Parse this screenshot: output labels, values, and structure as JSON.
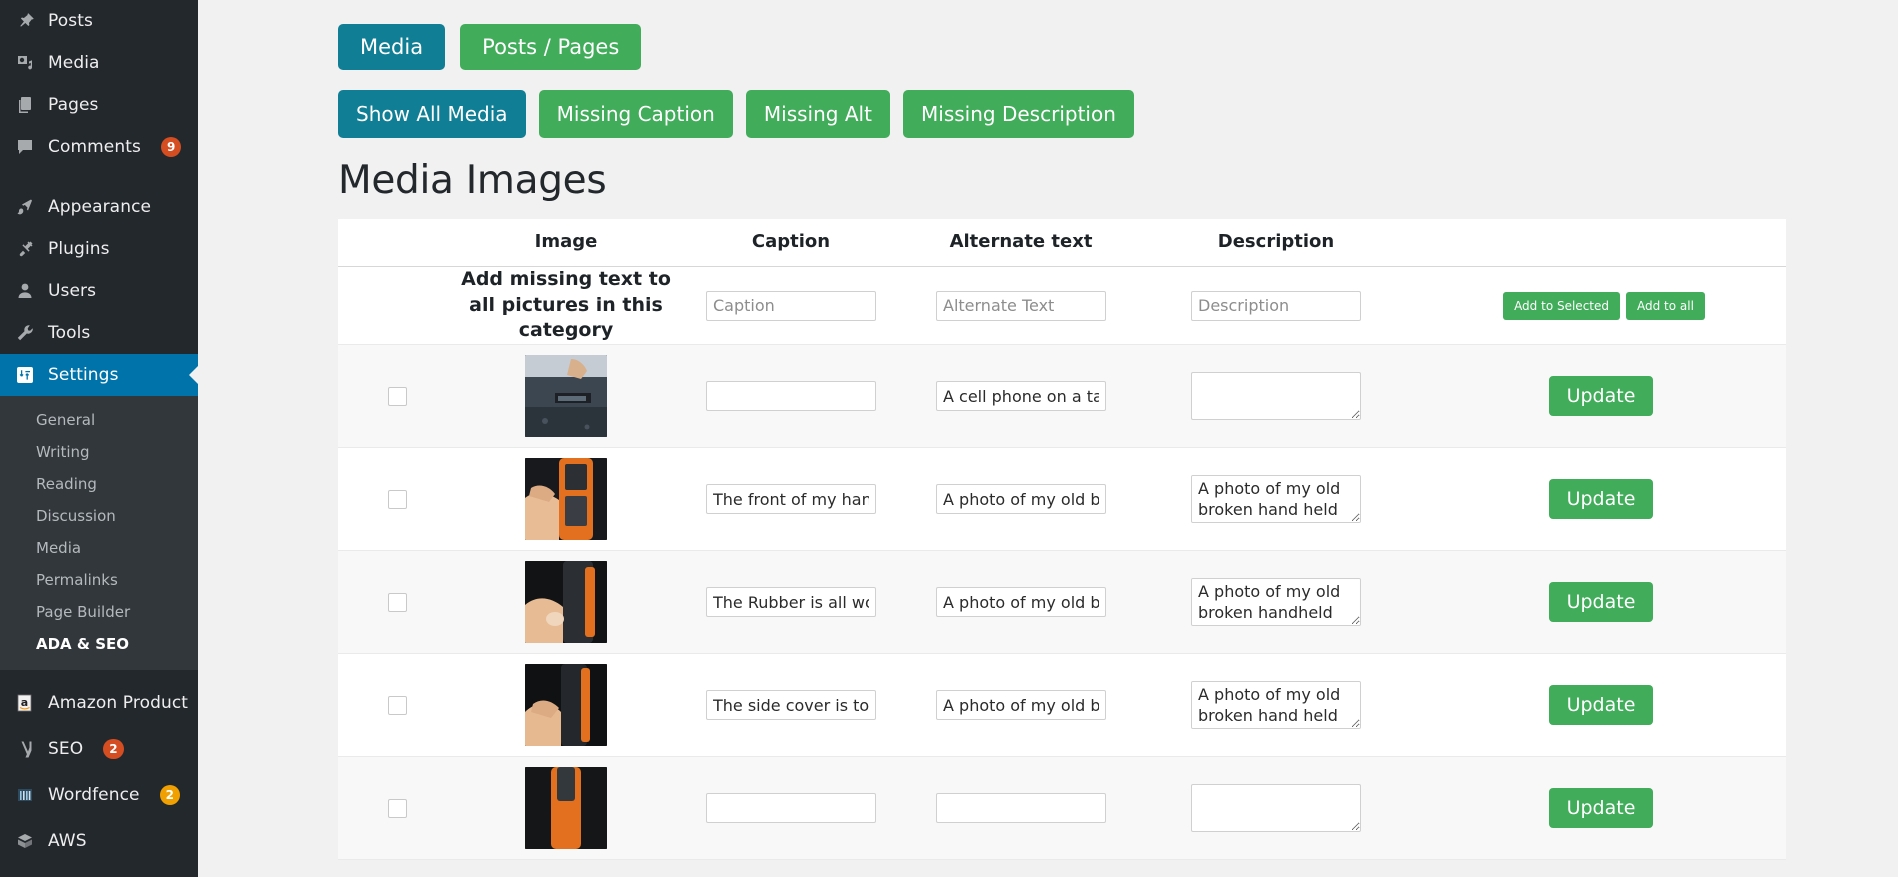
{
  "sidebar": {
    "items": [
      {
        "label": "Posts",
        "icon": "pin-icon",
        "badge": null,
        "active": false
      },
      {
        "label": "Media",
        "icon": "media-icon",
        "badge": null,
        "active": false
      },
      {
        "label": "Pages",
        "icon": "pages-icon",
        "badge": null,
        "active": false
      },
      {
        "label": "Comments",
        "icon": "comment-icon",
        "badge": "9",
        "active": false
      },
      {
        "label": "Appearance",
        "icon": "brush-icon",
        "badge": null,
        "active": false
      },
      {
        "label": "Plugins",
        "icon": "plug-icon",
        "badge": null,
        "active": false
      },
      {
        "label": "Users",
        "icon": "user-icon",
        "badge": null,
        "active": false
      },
      {
        "label": "Tools",
        "icon": "wrench-icon",
        "badge": null,
        "active": false
      },
      {
        "label": "Settings",
        "icon": "settings-icon",
        "badge": null,
        "active": true
      }
    ],
    "submenu": [
      {
        "label": "General",
        "current": false
      },
      {
        "label": "Writing",
        "current": false
      },
      {
        "label": "Reading",
        "current": false
      },
      {
        "label": "Discussion",
        "current": false
      },
      {
        "label": "Media",
        "current": false
      },
      {
        "label": "Permalinks",
        "current": false
      },
      {
        "label": "Page Builder",
        "current": false
      },
      {
        "label": "ADA & SEO",
        "current": true
      }
    ],
    "plugins": [
      {
        "label": "Amazon Product",
        "icon": "amazon-icon",
        "badge": null,
        "badge_color": null
      },
      {
        "label": "SEO",
        "icon": "yoast-icon",
        "badge": "2",
        "badge_color": "#d54e21"
      },
      {
        "label": "Wordfence",
        "icon": "wordfence-icon",
        "badge": "2",
        "badge_color": "#f0a000"
      },
      {
        "label": "AWS",
        "icon": "aws-icon",
        "badge": null,
        "badge_color": null
      }
    ]
  },
  "colors": {
    "accent_green": "#41ac5a",
    "accent_teal": "#107e94",
    "sidebar_bg": "#23282d",
    "submenu_bg": "#32373c",
    "active_blue": "#0073aa",
    "badge_orange": "#d54e21",
    "badge_amber": "#f0a000"
  },
  "toolbar": {
    "type_tabs": [
      {
        "label": "Media",
        "active": true
      },
      {
        "label": "Posts / Pages",
        "active": false
      }
    ],
    "filter_tabs": [
      {
        "label": "Show All Media",
        "active": true
      },
      {
        "label": "Missing Caption",
        "active": false
      },
      {
        "label": "Missing Alt",
        "active": false
      },
      {
        "label": "Missing Description",
        "active": false
      }
    ]
  },
  "page_title": "Media Images",
  "table": {
    "columns": [
      "",
      "Image",
      "Caption",
      "Alternate text",
      "Description",
      ""
    ],
    "bulk_row": {
      "label_line1": "Add missing text to",
      "label_line2": "all pictures in this category",
      "caption_placeholder": "Caption",
      "alt_placeholder": "Alternate Text",
      "description_placeholder": "Description",
      "add_to_selected_label": "Add to Selected",
      "add_to_all_label": "Add to all"
    },
    "update_label": "Update",
    "rows": [
      {
        "checked": false,
        "thumb": "hand-on-phone-dark-table",
        "caption": "",
        "alt": "A cell phone on a table",
        "description": "",
        "desc_multiline": false,
        "update_label": "Update"
      },
      {
        "checked": false,
        "thumb": "orange-handheld-front",
        "caption": "The front of my hand held",
        "alt": "A photo of my old broker",
        "description": "A photo of my old broken hand held",
        "desc_multiline": true,
        "update_label": "Update"
      },
      {
        "checked": false,
        "thumb": "orange-handheld-rubber",
        "caption": "The Rubber is all worn ou",
        "alt": "A photo of my old broker",
        "description": "A photo of my old broken handheld",
        "desc_multiline": true,
        "update_label": "Update"
      },
      {
        "checked": false,
        "thumb": "orange-handheld-side",
        "caption": "The side cover is torn on ",
        "alt": "A photo of my old broker",
        "description": "A photo of my old broken hand held",
        "desc_multiline": true,
        "update_label": "Update"
      },
      {
        "checked": false,
        "thumb": "orange-handheld-bottom",
        "caption": "",
        "alt": "",
        "description": "",
        "desc_multiline": false,
        "update_label": "Update"
      }
    ]
  }
}
